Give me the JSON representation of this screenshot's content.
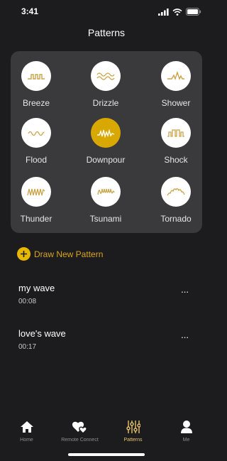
{
  "status_bar": {
    "time": "3:41"
  },
  "header": {
    "title": "Patterns"
  },
  "patterns": [
    {
      "label": "Breeze",
      "icon": "breeze-wave-icon",
      "active": false
    },
    {
      "label": "Drizzle",
      "icon": "drizzle-wave-icon",
      "active": false
    },
    {
      "label": "Shower",
      "icon": "shower-wave-icon",
      "active": false
    },
    {
      "label": "Flood",
      "icon": "flood-wave-icon",
      "active": false
    },
    {
      "label": "Downpour",
      "icon": "downpour-wave-icon",
      "active": true
    },
    {
      "label": "Shock",
      "icon": "shock-wave-icon",
      "active": false
    },
    {
      "label": "Thunder",
      "icon": "thunder-wave-icon",
      "active": false
    },
    {
      "label": "Tsunami",
      "icon": "tsunami-wave-icon",
      "active": false
    },
    {
      "label": "Tornado",
      "icon": "tornado-wave-icon",
      "active": false
    }
  ],
  "draw_new": {
    "label": "Draw New Pattern"
  },
  "my_waves": [
    {
      "name": "my wave",
      "duration": "00:08",
      "more": "..."
    },
    {
      "name": "love's wave",
      "duration": "00:17",
      "more": "..."
    }
  ],
  "tab_bar": {
    "tabs": [
      {
        "label": "Home",
        "icon": "home-icon",
        "active": false
      },
      {
        "label": "Remote Connect",
        "icon": "hearts-icon",
        "active": false
      },
      {
        "label": "Patterns",
        "icon": "sliders-icon",
        "active": true
      },
      {
        "label": "Me",
        "icon": "person-icon",
        "active": false
      }
    ]
  },
  "colors": {
    "background": "#1c1c1e",
    "card": "#3a3a3c",
    "accent": "#d9a800",
    "accent_text": "#d9a520",
    "icon_stroke": "#c8a44a"
  }
}
